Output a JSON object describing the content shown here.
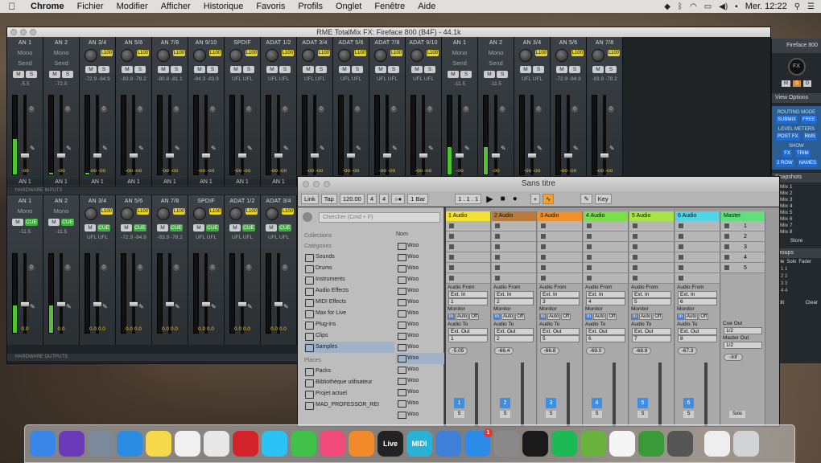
{
  "menubar": {
    "items": [
      "Chrome",
      "Fichier",
      "Modifier",
      "Afficher",
      "Historique",
      "Favoris",
      "Profils",
      "Onglet",
      "Fenêtre",
      "Aide"
    ],
    "clock": "Mer. 12:22"
  },
  "totalmix": {
    "title": "RME TotalMix FX: Fireface 800 (B4F) - 44.1k",
    "hardware_inputs_label": "HARDWARE INPUTS",
    "hardware_outputs_label": "HARDWARE OUTPUTS",
    "top_channels": [
      {
        "name": "AN 1",
        "mono": "Mono",
        "send": "Send",
        "level": "-5.5",
        "bottom": "-oo",
        "label": "AN 1",
        "meter": 0.45
      },
      {
        "name": "AN 2",
        "mono": "Mono",
        "send": "Send",
        "level": "-72.0",
        "bottom": "-oo",
        "label": "AN 1",
        "meter": 0.02
      },
      {
        "name": "AN 3/4",
        "level": "-72.9 -84.9",
        "bottom": "-oo  -oo",
        "label": "AN 1",
        "meter": 0.02
      },
      {
        "name": "AN 5/6",
        "level": "-83.9 -78.2",
        "bottom": "-oo  -oo",
        "label": "AN 1",
        "meter": 0
      },
      {
        "name": "AN 7/8",
        "level": "-80.8 -81.1",
        "bottom": "-oo  -oo",
        "label": "AN 1",
        "meter": 0
      },
      {
        "name": "AN 9/10",
        "level": "-84.3 -83.9",
        "bottom": "-oo  -oo",
        "label": "AN 1",
        "meter": 0
      },
      {
        "name": "SPDIF",
        "level": "UFL  UFL",
        "bottom": "-oo  -oo",
        "label": "AN 1",
        "meter": 0
      },
      {
        "name": "ADAT 1/2",
        "level": "UFL  UFL",
        "bottom": "-oo  -oo",
        "label": "AN 1",
        "meter": 0
      },
      {
        "name": "ADAT 3/4",
        "level": "UFL  UFL",
        "bottom": "-oo  -oo",
        "label": "AN 1",
        "meter": 0
      },
      {
        "name": "ADAT 5/6",
        "level": "UFL  UFL",
        "bottom": "-oo  -oo",
        "label": "AN 1",
        "meter": 0
      },
      {
        "name": "ADAT 7/8",
        "level": "UFL  UFL",
        "bottom": "-oo  -oo",
        "label": "AN 1",
        "meter": 0
      },
      {
        "name": "ADAT 9/10",
        "level": "UFL  UFL",
        "bottom": "-oo  -oo",
        "label": "AN 1",
        "meter": 0
      },
      {
        "name": "AN 1",
        "mono": "Mono",
        "send": "Send",
        "level": "-11.5",
        "bottom": "-oo",
        "label": "AN 1",
        "meter": 0.35
      },
      {
        "name": "AN 2",
        "mono": "Mono",
        "send": "Send",
        "level": "-11.5",
        "bottom": "-oo",
        "label": "AN 1",
        "meter": 0.35
      },
      {
        "name": "AN 3/4",
        "level": "UFL  UFL",
        "bottom": "-oo  -oo",
        "label": "AN 1",
        "meter": 0
      },
      {
        "name": "AN 5/6",
        "level": "-72.9 -84.9",
        "bottom": "-oo  -oo",
        "label": "AN 1",
        "meter": 0
      },
      {
        "name": "AN 7/8",
        "level": "-83.9 -78.2",
        "bottom": "-oo  -oo",
        "label": "AN 1",
        "meter": 0
      }
    ],
    "bottom_channels": [
      {
        "name": "AN 1",
        "mono": "Mono",
        "level": "-11.5",
        "bottom": "0.0",
        "meter": 0.35
      },
      {
        "name": "AN 2",
        "mono": "Mono",
        "level": "-11.5",
        "bottom": "0.0",
        "meter": 0.35
      },
      {
        "name": "AN 3/4",
        "level": "UFL  UFL",
        "bottom": "0.0  0.0",
        "meter": 0
      },
      {
        "name": "AN 5/6",
        "level": "-72.9 -84.9",
        "bottom": "0.0  0.0",
        "meter": 0
      },
      {
        "name": "AN 7/8",
        "level": "-83.9 -78.2",
        "bottom": "0.0  0.0",
        "meter": 0
      },
      {
        "name": "SPDIF",
        "level": "UFL  UFL",
        "bottom": "0.0  0.0",
        "meter": 0
      },
      {
        "name": "ADAT 1/2",
        "level": "UFL  UFL",
        "bottom": "0.0  0.0",
        "meter": 0
      },
      {
        "name": "ADAT 3/4",
        "level": "UFL  UFL",
        "bottom": "0.0  0.0",
        "meter": 0
      }
    ],
    "right_panel": {
      "device": "Fireface 800",
      "fx": "FX",
      "view_options": "View Options",
      "routing_mode": "ROUTING MODE",
      "submix": "SUBMIX",
      "free": "FREE",
      "level_meters": "LEVEL METERS",
      "postfx": "POST FX",
      "rms": "RMS",
      "show": "SHOW",
      "fx_btn": "FX",
      "trim": "TRIM",
      "row": "2 ROW",
      "names": "NAMES",
      "snapshots": "Snapshots",
      "mixes": [
        "Mix 1",
        "Mix 2",
        "Mix 3",
        "Mix 4",
        "Mix 5",
        "Mix 6",
        "Mix 7",
        "Mix 8"
      ],
      "store": "Store",
      "groups": "Groups",
      "mute": "Mute",
      "solo": "Solo",
      "fader": "Fader",
      "edit": "Edit",
      "clear": "Clear"
    }
  },
  "live": {
    "title": "Sans titre",
    "link": "Link",
    "tap": "Tap",
    "tempo": "120.00",
    "sig_num": "4",
    "sig_den": "4",
    "quant": "1 Bar",
    "pos": "1 .  1 .  1",
    "key": "Key",
    "search_placeholder": "Chercher (Cmd + F)",
    "collections": "Collections",
    "categories": "Catégories",
    "cat_items": [
      "Sounds",
      "Drums",
      "Instruments",
      "Audio Effects",
      "MIDI Effects",
      "Max for Live",
      "Plug-ins",
      "Clips",
      "Samples"
    ],
    "places": "Places",
    "place_items": [
      "Packs",
      "Bibliothèque utilisateur",
      "Projet actuel",
      "MAD_PROFESSOR_REI"
    ],
    "name_col": "Nom",
    "files": [
      "Woo",
      "Woo",
      "Woo",
      "Woo",
      "Woo",
      "Woo",
      "Woo",
      "Woo",
      "Woo",
      "Woo",
      "Woo",
      "Woo",
      "Woo",
      "Woo",
      "Woo",
      "Woo"
    ],
    "tracks": [
      {
        "name": "1 Audio",
        "color": "#f2e233",
        "in": "Ext. In",
        "ch": "1",
        "out": "Ext. Out",
        "och": "1",
        "vol": "-5.05",
        "num": "1"
      },
      {
        "name": "2 Audio",
        "color": "#b87a3d",
        "in": "Ext. In",
        "ch": "2",
        "out": "Ext. Out",
        "och": "2",
        "vol": "-66.4",
        "num": "2"
      },
      {
        "name": "3 Audio",
        "color": "#f0902c",
        "in": "Ext. In",
        "ch": "3",
        "out": "Ext. Out",
        "och": "5",
        "vol": "-66.8",
        "num": "3"
      },
      {
        "name": "4 Audio",
        "color": "#79e04a",
        "in": "Ext. In",
        "ch": "4",
        "out": "Ext. Out",
        "och": "6",
        "vol": "-69.0",
        "num": "4"
      },
      {
        "name": "5 Audio",
        "color": "#a7e546",
        "in": "Ext. In",
        "ch": "5",
        "out": "Ext. Out",
        "och": "7",
        "vol": "-68.9",
        "num": "5"
      },
      {
        "name": "6 Audio",
        "color": "#4ed6e8",
        "in": "Ext. In",
        "ch": "6",
        "out": "Ext. Out",
        "och": "8",
        "vol": "-67.3",
        "num": "6"
      }
    ],
    "audio_from": "Audio From",
    "monitor": "Monitor",
    "audio_to": "Audio To",
    "in": "In",
    "auto": "Auto",
    "off": "Off",
    "s": "S",
    "master": {
      "name": "Master",
      "scenes": [
        "1",
        "2",
        "3",
        "4",
        "5"
      ],
      "cue_out": "Cue Out",
      "cue_val": "1/2",
      "master_out": "Master Out",
      "master_val": "1/2",
      "vol": "-Inf",
      "solo": "Solo"
    }
  },
  "dock": {
    "items": [
      {
        "name": "finder-icon",
        "color": "#3a86e8",
        "text": ""
      },
      {
        "name": "siri-icon",
        "color": "#6a3ab8",
        "text": ""
      },
      {
        "name": "launchpad-icon",
        "color": "#7a8a9a",
        "text": ""
      },
      {
        "name": "safari-icon",
        "color": "#2b8be0",
        "text": ""
      },
      {
        "name": "notes-icon",
        "color": "#f5d94a",
        "text": ""
      },
      {
        "name": "photos-icon",
        "color": "#f0f0f0",
        "text": ""
      },
      {
        "name": "chrome-icon",
        "color": "#e8e8e8",
        "text": ""
      },
      {
        "name": "opera-icon",
        "color": "#d3232a",
        "text": ""
      },
      {
        "name": "messages-icon",
        "color": "#2bc2f5",
        "text": ""
      },
      {
        "name": "facetime-icon",
        "color": "#3fc14a",
        "text": ""
      },
      {
        "name": "itunes-icon",
        "color": "#f04a7a",
        "text": ""
      },
      {
        "name": "books-icon",
        "color": "#f08a2a",
        "text": ""
      },
      {
        "name": "ableton-live-icon",
        "color": "#222",
        "text": "Live"
      },
      {
        "name": "midi-icon",
        "color": "#2ab1d6",
        "text": "MIDI"
      },
      {
        "name": "network-icon",
        "color": "#3e7fd8",
        "text": ""
      },
      {
        "name": "app-store-icon",
        "color": "#2a8be8",
        "text": "",
        "badge": "1"
      },
      {
        "name": "system-preferences-icon",
        "color": "#8a8a8a",
        "text": ""
      },
      {
        "name": "piano-icon",
        "color": "#1a1a1a",
        "text": ""
      },
      {
        "name": "spotify-icon",
        "color": "#1db954",
        "text": ""
      },
      {
        "name": "utorrent-icon",
        "color": "#6ab23e",
        "text": ""
      },
      {
        "name": "shazam-icon",
        "color": "#f5f5f5",
        "text": ""
      },
      {
        "name": "recorder-icon",
        "color": "#3a9a3a",
        "text": ""
      },
      {
        "name": "totalmix-icon",
        "color": "#555",
        "text": ""
      },
      {
        "name": "document-icon",
        "color": "#eee",
        "text": ""
      },
      {
        "name": "trash-icon",
        "color": "#cfd3d6",
        "text": ""
      }
    ]
  }
}
